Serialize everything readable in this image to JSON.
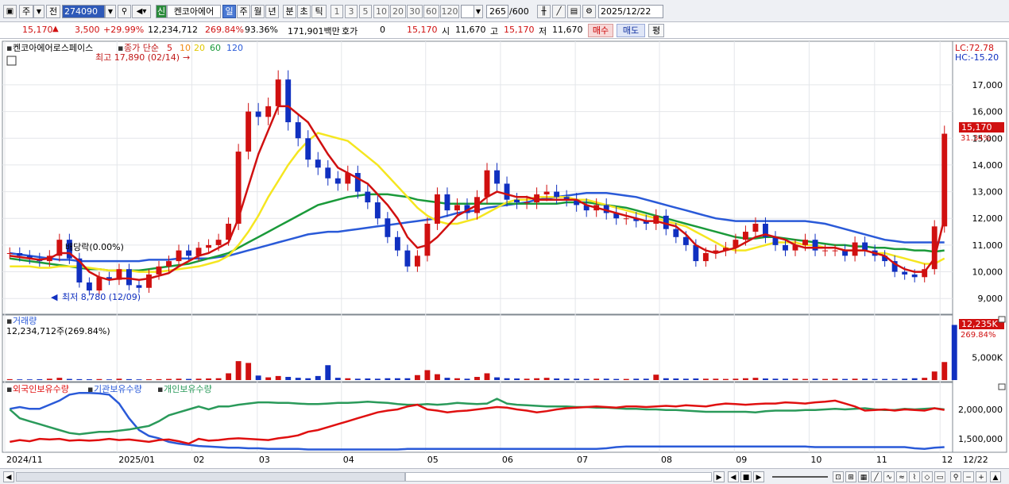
{
  "toolbar": {
    "code": "274090",
    "period_label_1": "주",
    "period_label_2": "전",
    "sin_badge": "신",
    "stock_name": "켄코아에어",
    "periods": [
      "일",
      "주",
      "월",
      "년",
      "분",
      "초",
      "틱"
    ],
    "selected_period": "일",
    "intervals": [
      "1",
      "3",
      "5",
      "10",
      "20",
      "30",
      "60",
      "120"
    ],
    "count": "265",
    "count_total": "/600",
    "date": "2025/12/22"
  },
  "quote": {
    "price": "15,170",
    "change": "3,500",
    "change_pct": "+29.99%",
    "volume": "12,234,712",
    "vol_ratio": "269.84%",
    "turnover_ratio": "93.36%",
    "amount": "171,901백만",
    "hoga_label": "호가",
    "hoga": "0",
    "hoga_price": "15,170",
    "open_label": "시",
    "open": "11,670",
    "high_label": "고",
    "high": "15,170",
    "low_label": "저",
    "low": "11,670",
    "buy_label": "매수",
    "sell_label": "매도",
    "flat_label": "평"
  },
  "price_panel": {
    "title": "켄코아에어로스페이스",
    "legend_prefix": "종가 단순",
    "ma_labels": [
      "5",
      "10",
      "20",
      "60",
      "120"
    ],
    "lc": "LC:72.78",
    "hc": "HC:-15.20",
    "max_note": "최고 17,890 (02/14)",
    "min_note": "최저 8,780 (12/09)",
    "dividend_note": "배당락(0.00%)",
    "last_price_tag": "15,170",
    "last_pct_tag": "31.34%"
  },
  "volume_panel": {
    "title": "거래량",
    "value": "12,234,712주(269.84%)",
    "tag": "12,235K",
    "tag_pct": "269.84%"
  },
  "holdings_panel": {
    "labels": [
      "외국인보유수량",
      "기관보유수량",
      "개인보유수량"
    ]
  },
  "colors": {
    "up": "#d01010",
    "down": "#1030c0",
    "ma5": "#d01010",
    "ma10": "#f08a10",
    "ma20": "#f5e620",
    "ma60": "#1a9a3a",
    "ma120": "#2a5ad8",
    "foreign": "#e01010",
    "institution": "#2a5ad8",
    "individual": "#2a9a5a"
  },
  "chart_data": {
    "type": "candlestick",
    "price_axis": {
      "min": 9000,
      "max": 17000,
      "ticks": [
        9000,
        10000,
        11000,
        12000,
        13000,
        14000,
        15000,
        16000,
        17000
      ],
      "tick_labels": [
        "9,000",
        "10,000",
        "11,000",
        "12,000",
        "13,000",
        "14,000",
        "15,000",
        "16,000",
        "17,000"
      ]
    },
    "volume_axis": {
      "ticks": [
        5000000
      ],
      "tick_labels": [
        "5,000K"
      ]
    },
    "holdings_axis": {
      "ticks": [
        1500000,
        2000000
      ],
      "tick_labels": [
        "1,500,000",
        "2,000,000"
      ]
    },
    "x_labels": [
      "2024/11",
      "2025/01",
      "02",
      "03",
      "04",
      "05",
      "06",
      "07",
      "08",
      "09",
      "10",
      "11",
      "12",
      "12/22"
    ],
    "close_series": [
      10700,
      10600,
      10500,
      10400,
      10600,
      11200,
      10500,
      9600,
      9300,
      9800,
      9700,
      10100,
      9500,
      9400,
      9900,
      10200,
      10400,
      10800,
      10600,
      10900,
      11000,
      11200,
      11800,
      14500,
      16000,
      15800,
      16200,
      17200,
      15600,
      15000,
      14200,
      13900,
      13500,
      13300,
      13700,
      13000,
      12600,
      12000,
      11300,
      10800,
      10200,
      10600,
      11800,
      12900,
      12300,
      12500,
      12200,
      12800,
      13800,
      13300,
      12700,
      12600,
      12600,
      12900,
      13000,
      12800,
      12700,
      12500,
      12300,
      12500,
      12200,
      12000,
      12000,
      11900,
      11800,
      12100,
      11600,
      11300,
      11000,
      10400,
      10700,
      10800,
      10900,
      11200,
      11500,
      11800,
      11300,
      11000,
      10800,
      11000,
      11200,
      10800,
      10800,
      10800,
      10600,
      11100,
      10800,
      10600,
      10400,
      10000,
      9900,
      9800,
      10100,
      11700,
      15170
    ],
    "volume_series_k": [
      200,
      150,
      150,
      180,
      300,
      500,
      250,
      200,
      180,
      220,
      150,
      300,
      200,
      150,
      180,
      200,
      250,
      300,
      250,
      300,
      350,
      400,
      1500,
      4200,
      3800,
      1000,
      600,
      900,
      700,
      500,
      400,
      900,
      3300,
      500,
      400,
      300,
      350,
      300,
      400,
      400,
      400,
      1100,
      2200,
      1300,
      500,
      400,
      300,
      700,
      1500,
      600,
      400,
      350,
      300,
      400,
      500,
      350,
      300,
      300,
      250,
      300,
      300,
      250,
      250,
      300,
      300,
      1200,
      400,
      350,
      300,
      350,
      300,
      300,
      250,
      300,
      400,
      500,
      350,
      300,
      300,
      300,
      250,
      300,
      250,
      300,
      250,
      300,
      300,
      250,
      250,
      250,
      300,
      400,
      500,
      1900,
      4000,
      12235
    ],
    "ma_series": {
      "ma5": [
        10600,
        10550,
        10500,
        10450,
        10500,
        10700,
        10700,
        10400,
        10000,
        9800,
        9700,
        9750,
        9750,
        9700,
        9750,
        9850,
        9950,
        10200,
        10400,
        10600,
        10700,
        10900,
        11100,
        12000,
        13200,
        14400,
        15300,
        16200,
        16200,
        15900,
        15600,
        15000,
        14400,
        13900,
        13700,
        13500,
        13300,
        12900,
        12500,
        12000,
        11300,
        10900,
        11000,
        11300,
        11700,
        12100,
        12300,
        12500,
        12800,
        13000,
        12900,
        12800,
        12800,
        12700,
        12700,
        12700,
        12700,
        12700,
        12500,
        12400,
        12300,
        12200,
        12100,
        12000,
        11900,
        11900,
        11800,
        11700,
        11400,
        11000,
        10800,
        10700,
        10800,
        10900,
        11100,
        11300,
        11400,
        11300,
        11200,
        11000,
        10900,
        10900,
        10900,
        10900,
        10800,
        10800,
        10800,
        10700,
        10600,
        10300,
        10100,
        10000,
        10000,
        10500,
        12000
      ],
      "ma20": [
        10200,
        10200,
        10200,
        10150,
        10150,
        10200,
        10200,
        10200,
        10150,
        10100,
        10050,
        10050,
        10050,
        10000,
        10000,
        10000,
        10050,
        10100,
        10150,
        10200,
        10300,
        10400,
        10600,
        11000,
        11500,
        12100,
        12800,
        13400,
        14000,
        14500,
        14900,
        15200,
        15100,
        15000,
        14900,
        14600,
        14300,
        14000,
        13600,
        13200,
        12800,
        12400,
        12100,
        11900,
        11800,
        11800,
        11900,
        12000,
        12200,
        12400,
        12600,
        12700,
        12700,
        12800,
        12800,
        12800,
        12800,
        12700,
        12700,
        12600,
        12500,
        12400,
        12300,
        12200,
        12100,
        12000,
        11900,
        11800,
        11700,
        11500,
        11300,
        11100,
        10900,
        10800,
        10800,
        10900,
        11000,
        11100,
        11100,
        11100,
        11000,
        11000,
        10900,
        10900,
        10800,
        10800,
        10800,
        10700,
        10700,
        10600,
        10500,
        10400,
        10300,
        10300,
        10500
      ],
      "ma60": [
        10500,
        10450,
        10400,
        10350,
        10300,
        10250,
        10200,
        10150,
        10100,
        10100,
        10050,
        10050,
        10050,
        10050,
        10100,
        10150,
        10200,
        10250,
        10300,
        10400,
        10500,
        10600,
        10700,
        10900,
        11100,
        11300,
        11500,
        11700,
        11900,
        12100,
        12300,
        12500,
        12600,
        12700,
        12800,
        12850,
        12900,
        12900,
        12900,
        12850,
        12800,
        12700,
        12650,
        12600,
        12550,
        12550,
        12550,
        12550,
        12550,
        12550,
        12550,
        12550,
        12550,
        12550,
        12550,
        12550,
        12600,
        12600,
        12600,
        12550,
        12500,
        12450,
        12400,
        12300,
        12200,
        12100,
        12000,
        11900,
        11800,
        11700,
        11600,
        11500,
        11400,
        11300,
        11250,
        11250,
        11300,
        11300,
        11250,
        11200,
        11150,
        11100,
        11050,
        11000,
        11000,
        10950,
        10950,
        10900,
        10900,
        10850,
        10850,
        10800,
        10800,
        10750,
        10800
      ],
      "ma120": [
        10700,
        10650,
        10600,
        10550,
        10500,
        10450,
        10450,
        10400,
        10400,
        10400,
        10400,
        10400,
        10400,
        10400,
        10450,
        10450,
        10450,
        10500,
        10500,
        10500,
        10500,
        10550,
        10600,
        10700,
        10800,
        10900,
        11000,
        11100,
        11200,
        11300,
        11400,
        11450,
        11500,
        11500,
        11550,
        11600,
        11650,
        11700,
        11750,
        11800,
        11850,
        11900,
        11950,
        12000,
        12100,
        12200,
        12250,
        12300,
        12400,
        12450,
        12500,
        12550,
        12600,
        12700,
        12750,
        12800,
        12850,
        12900,
        12950,
        12950,
        12950,
        12900,
        12850,
        12800,
        12700,
        12600,
        12500,
        12400,
        12300,
        12200,
        12100,
        12000,
        11950,
        11900,
        11900,
        11900,
        11900,
        11900,
        11900,
        11900,
        11900,
        11850,
        11800,
        11700,
        11600,
        11500,
        11400,
        11300,
        11200,
        11150,
        11100,
        11100,
        11100,
        11100,
        11100
      ]
    },
    "holdings_series": {
      "foreign": [
        1450,
        1480,
        1460,
        1500,
        1490,
        1500,
        1470,
        1480,
        1470,
        1480,
        1500,
        1480,
        1490,
        1470,
        1450,
        1480,
        1490,
        1460,
        1420,
        1500,
        1470,
        1480,
        1500,
        1510,
        1500,
        1490,
        1480,
        1510,
        1530,
        1560,
        1620,
        1650,
        1700,
        1750,
        1800,
        1850,
        1900,
        1950,
        1980,
        2000,
        2050,
        2080,
        2000,
        1980,
        1950,
        1970,
        1980,
        2000,
        2020,
        2040,
        2030,
        2000,
        1980,
        1950,
        1970,
        2000,
        2020,
        2030,
        2040,
        2050,
        2040,
        2030,
        2050,
        2050,
        2040,
        2050,
        2060,
        2050,
        2070,
        2060,
        2050,
        2080,
        2100,
        2090,
        2080,
        2090,
        2100,
        2100,
        2120,
        2110,
        2100,
        2120,
        2130,
        2150,
        2100,
        2050,
        1980,
        1990,
        2000,
        1980,
        2000,
        1990,
        1980,
        2020,
        1990
      ],
      "institution": [
        2010,
        2040,
        2010,
        2010,
        2080,
        2150,
        2250,
        2280,
        2280,
        2270,
        2250,
        2100,
        1850,
        1650,
        1550,
        1510,
        1450,
        1420,
        1400,
        1380,
        1370,
        1360,
        1350,
        1350,
        1340,
        1340,
        1330,
        1330,
        1330,
        1330,
        1320,
        1320,
        1320,
        1320,
        1320,
        1320,
        1320,
        1320,
        1320,
        1320,
        1330,
        1330,
        1330,
        1330,
        1330,
        1330,
        1330,
        1330,
        1330,
        1330,
        1330,
        1330,
        1330,
        1330,
        1330,
        1330,
        1330,
        1330,
        1330,
        1330,
        1340,
        1360,
        1370,
        1370,
        1370,
        1370,
        1370,
        1370,
        1370,
        1370,
        1370,
        1370,
        1370,
        1370,
        1370,
        1370,
        1370,
        1370,
        1370,
        1370,
        1370,
        1360,
        1360,
        1360,
        1360,
        1360,
        1360,
        1360,
        1360,
        1360,
        1360,
        1340,
        1330,
        1350,
        1360
      ],
      "individual": [
        2000,
        1850,
        1800,
        1750,
        1700,
        1650,
        1600,
        1580,
        1600,
        1620,
        1620,
        1640,
        1660,
        1690,
        1720,
        1800,
        1900,
        1950,
        2000,
        2050,
        2000,
        2050,
        2050,
        2080,
        2100,
        2120,
        2120,
        2110,
        2110,
        2100,
        2090,
        2090,
        2100,
        2110,
        2110,
        2120,
        2130,
        2120,
        2110,
        2090,
        2080,
        2080,
        2090,
        2080,
        2090,
        2110,
        2100,
        2090,
        2100,
        2180,
        2100,
        2080,
        2070,
        2060,
        2050,
        2050,
        2050,
        2040,
        2040,
        2030,
        2030,
        2020,
        2010,
        2010,
        2000,
        2000,
        1990,
        1990,
        1980,
        1970,
        1960,
        1960,
        1960,
        1960,
        1960,
        1950,
        1970,
        1980,
        1980,
        1980,
        1990,
        1990,
        2000,
        2010,
        2000,
        2010,
        2020,
        2000,
        1990,
        1990,
        2010,
        2000,
        2010,
        2020,
        2000
      ]
    }
  }
}
